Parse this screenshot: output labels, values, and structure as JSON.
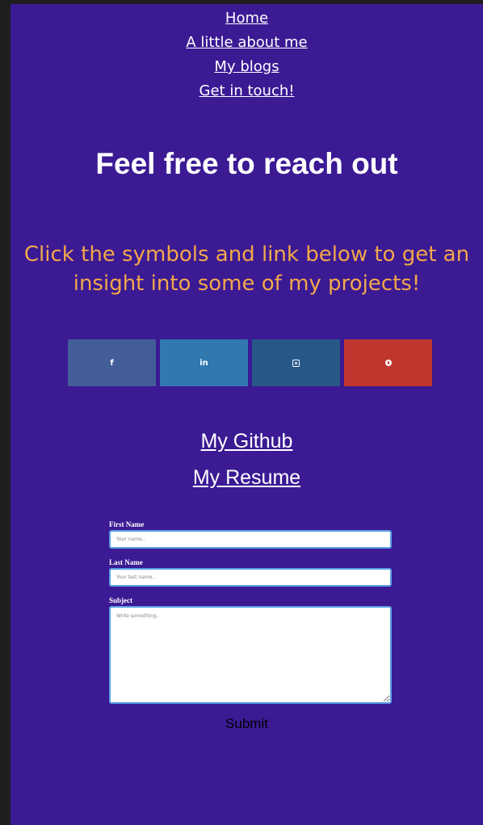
{
  "nav": {
    "items": [
      {
        "label": "Home"
      },
      {
        "label": "A little about me"
      },
      {
        "label": "My blogs"
      },
      {
        "label": "Get in touch!"
      }
    ]
  },
  "main": {
    "headline": "Feel free to reach out",
    "subheading": "Click the symbols and link below to get an insight into some of my projects!"
  },
  "social": {
    "tiles": [
      {
        "glyph": "f",
        "icon": "facebook-icon",
        "color": "#435d98"
      },
      {
        "glyph": "in",
        "icon": "linkedin-icon",
        "color": "#3178b0"
      },
      {
        "glyph": "",
        "icon": "instagram-icon",
        "color": "#285888"
      },
      {
        "glyph": "",
        "icon": "pinterest-icon",
        "color": "#c0362e"
      }
    ]
  },
  "links": {
    "github": "My Github",
    "resume": "My Resume"
  },
  "form": {
    "first_name": {
      "label": "First Name",
      "placeholder": "Your name.."
    },
    "last_name": {
      "label": "Last Name",
      "placeholder": "Your last name.."
    },
    "subject": {
      "label": "Subject",
      "placeholder": "Write something.."
    },
    "submit_label": "Submit"
  },
  "colors": {
    "page_background": "#3b1a94",
    "subheading": "#f2a74b",
    "outer_background": "#1e1e1e",
    "input_border": "#5b9ee6"
  }
}
